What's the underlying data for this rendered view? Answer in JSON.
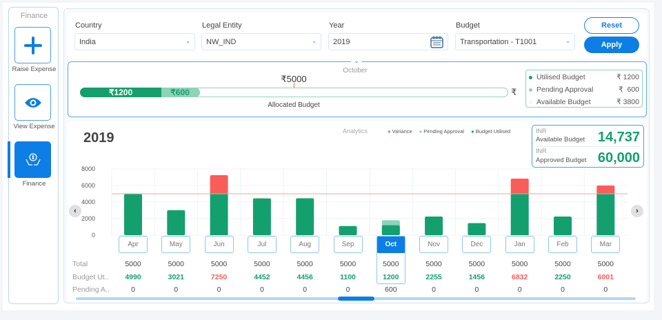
{
  "sidebar": {
    "title": "Finance",
    "items": [
      {
        "label": "Raise Expense",
        "icon": "plus-icon"
      },
      {
        "label": "View Expense",
        "icon": "eye-icon"
      },
      {
        "label": "Finance",
        "icon": "money-hands-icon",
        "active": true
      }
    ]
  },
  "filters": {
    "country": {
      "label": "Country",
      "value": "India"
    },
    "legal_entity": {
      "label": "Legal Entity",
      "value": "NW_IND"
    },
    "year": {
      "label": "Year",
      "value": "2019"
    },
    "budget": {
      "label": "Budget",
      "value": "Transportation - T1001"
    },
    "reset_label": "Reset",
    "apply_label": "Apply"
  },
  "allocation": {
    "month": "October",
    "allocated_value": "₹5000",
    "allocated_label": "Allocated Budget",
    "utilised_fill": "₹1200",
    "pending_fill": "₹600",
    "currency_symbol": "₹",
    "legend": [
      {
        "label": "Utilised Budget",
        "value": "₹ 1200",
        "color": "#14a06e"
      },
      {
        "label": "Pending Approval",
        "value": "₹  600",
        "color": "#8fd3b8"
      },
      {
        "label": "Available Budget",
        "value": "₹ 3800",
        "color": "#ffffff"
      }
    ]
  },
  "chart_header": {
    "year": "2019",
    "analytics_label": "Analytics",
    "legend": [
      {
        "label": "Variance",
        "color": "#f95d5a"
      },
      {
        "label": "Pending Approval",
        "color": "#8fd3b8"
      },
      {
        "label": "Budget Utilised",
        "color": "#14a06e"
      }
    ]
  },
  "summary": {
    "available": {
      "currency": "INR",
      "label": "Available Budget",
      "value": "14,737"
    },
    "approved": {
      "currency": "INR",
      "label": "Approved Budget",
      "value": "60,000"
    }
  },
  "table": {
    "row_labels": [
      "Total",
      "Budget Ut..",
      "Pending A.."
    ],
    "selected_month": "Oct"
  },
  "chart_data": {
    "type": "bar",
    "stacked": true,
    "categories": [
      "Apr",
      "May",
      "Jun",
      "Jul",
      "Aug",
      "Sep",
      "Oct",
      "Nov",
      "Dec",
      "Jan",
      "Feb",
      "Mar"
    ],
    "total": [
      5000,
      5000,
      5000,
      5000,
      5000,
      5000,
      5000,
      5000,
      5000,
      5000,
      5000,
      5000
    ],
    "budget_utilised": [
      4990,
      3021,
      7250,
      4452,
      4456,
      1100,
      1200,
      2255,
      1456,
      6832,
      2250,
      6001
    ],
    "pending_approval": [
      0,
      0,
      0,
      0,
      0,
      0,
      600,
      0,
      0,
      0,
      0,
      0
    ],
    "reference_line": 5000,
    "yticks": [
      "8000",
      "6000",
      "4000",
      "2000",
      "0"
    ],
    "ylim": [
      0,
      8000
    ],
    "grid": true,
    "colors": {
      "utilised": "#14a06e",
      "pending": "#8fd3b8",
      "variance": "#f95d5a",
      "over_text": "#f95d5a"
    }
  }
}
